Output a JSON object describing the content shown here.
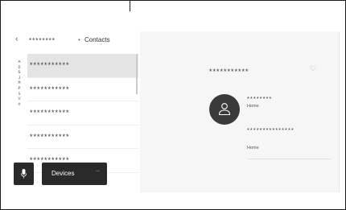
{
  "header": {
    "device_name": "********",
    "separator": "•",
    "title": "Contacts"
  },
  "index_letters": [
    "A",
    "D",
    "G",
    "J",
    "M",
    "P",
    "S",
    "V",
    "#"
  ],
  "contacts": [
    {
      "name": "***********",
      "selected": true
    },
    {
      "name": "***********",
      "selected": false
    },
    {
      "name": "***********",
      "selected": false
    },
    {
      "name": "***********",
      "selected": false
    },
    {
      "name": "***********",
      "selected": false
    }
  ],
  "buttons": {
    "devices_label": "Devices"
  },
  "detail": {
    "name": "***********",
    "phone1": {
      "number": "********",
      "label": "Home"
    },
    "phone2": {
      "number": "***************",
      "label": "Home"
    }
  },
  "icons": {
    "back": "chevron-left-icon",
    "mic": "microphone-icon",
    "favorite": "heart-icon",
    "avatar": "person-icon"
  },
  "colors": {
    "button_bg": "#2a2a2a",
    "avatar_bg": "#3a3a3a",
    "selected_bg": "#e4e4e4",
    "pane_bg": "#f6f6f6"
  }
}
